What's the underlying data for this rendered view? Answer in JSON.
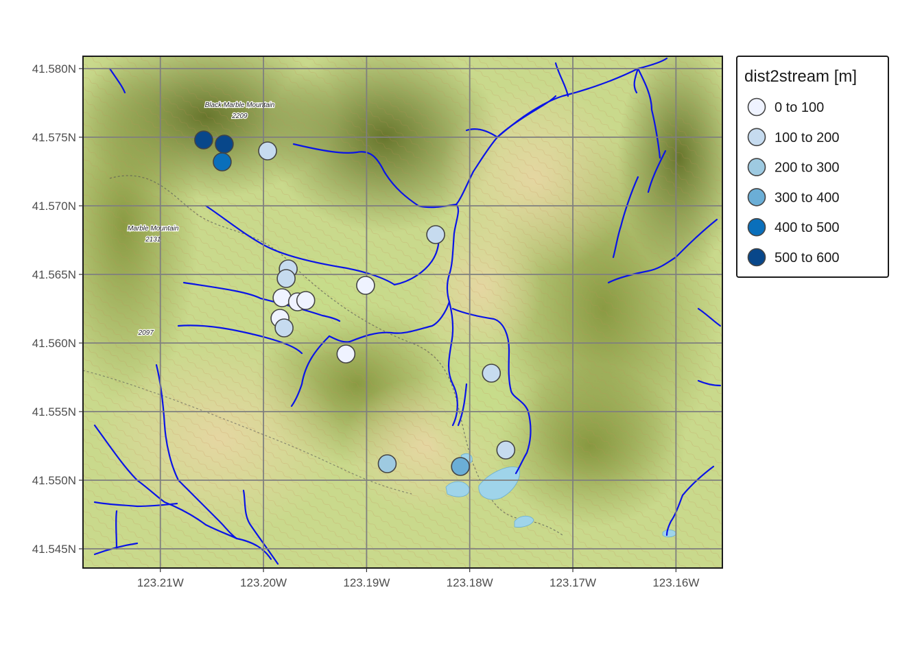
{
  "map": {
    "extent": {
      "lon_min": -123.2175,
      "lon_max": -123.1555,
      "lat_min": 41.5436,
      "lat_max": 41.5809
    },
    "x_ticks": [
      {
        "value": -123.21,
        "label": "123.21W"
      },
      {
        "value": -123.2,
        "label": "123.20W"
      },
      {
        "value": -123.19,
        "label": "123.19W"
      },
      {
        "value": -123.18,
        "label": "123.18W"
      },
      {
        "value": -123.17,
        "label": "123.17W"
      },
      {
        "value": -123.16,
        "label": "123.16W"
      }
    ],
    "y_ticks": [
      {
        "value": 41.58,
        "label": "41.580N"
      },
      {
        "value": 41.575,
        "label": "41.575N"
      },
      {
        "value": 41.57,
        "label": "41.570N"
      },
      {
        "value": 41.565,
        "label": "41.565N"
      },
      {
        "value": 41.56,
        "label": "41.560N"
      },
      {
        "value": 41.555,
        "label": "41.555N"
      },
      {
        "value": 41.55,
        "label": "41.550N"
      },
      {
        "value": 41.545,
        "label": "41.545N"
      }
    ],
    "basemap_labels": [
      {
        "name": "Black Marble Mountain",
        "lon": -123.2023,
        "lat": 41.5772
      },
      {
        "name": "2209",
        "lon": -123.2023,
        "lat": 41.5764
      },
      {
        "name": "Marble Mountain",
        "lon": -123.2107,
        "lat": 41.5682
      },
      {
        "name": "2131",
        "lon": -123.2107,
        "lat": 41.5674
      },
      {
        "name": "2097",
        "lon": -123.2114,
        "lat": 41.5606
      }
    ],
    "grid_color": "#7f7f7f",
    "stream_color": "#0a14e6",
    "lake_color": "#9fd4ea"
  },
  "legend": {
    "title": "dist2stream [m]",
    "items": [
      {
        "label": "0 to 100",
        "color": "#eff3ff"
      },
      {
        "label": "100 to 200",
        "color": "#c6dbef"
      },
      {
        "label": "200 to 300",
        "color": "#9ecae1"
      },
      {
        "label": "300 to 400",
        "color": "#6baed6"
      },
      {
        "label": "400 to 500",
        "color": "#0a6fbb"
      },
      {
        "label": "500 to 600",
        "color": "#08478a"
      }
    ]
  },
  "points": [
    {
      "lon": -123.2058,
      "lat": 41.5748,
      "class": 5
    },
    {
      "lon": -123.2038,
      "lat": 41.5745,
      "class": 5
    },
    {
      "lon": -123.204,
      "lat": 41.5732,
      "class": 4
    },
    {
      "lon": -123.1996,
      "lat": 41.574,
      "class": 1
    },
    {
      "lon": -123.1833,
      "lat": 41.5679,
      "class": 1
    },
    {
      "lon": -123.1976,
      "lat": 41.5654,
      "class": 1
    },
    {
      "lon": -123.1978,
      "lat": 41.5647,
      "class": 1
    },
    {
      "lon": -123.1901,
      "lat": 41.5642,
      "class": 0
    },
    {
      "lon": -123.1982,
      "lat": 41.5633,
      "class": 0
    },
    {
      "lon": -123.1967,
      "lat": 41.563,
      "class": 0
    },
    {
      "lon": -123.1959,
      "lat": 41.5631,
      "class": 0
    },
    {
      "lon": -123.1984,
      "lat": 41.5618,
      "class": 0
    },
    {
      "lon": -123.198,
      "lat": 41.5611,
      "class": 1
    },
    {
      "lon": -123.192,
      "lat": 41.5592,
      "class": 0
    },
    {
      "lon": -123.1779,
      "lat": 41.5578,
      "class": 1
    },
    {
      "lon": -123.1765,
      "lat": 41.5522,
      "class": 1
    },
    {
      "lon": -123.188,
      "lat": 41.5512,
      "class": 2
    },
    {
      "lon": -123.1809,
      "lat": 41.551,
      "class": 3
    }
  ]
}
